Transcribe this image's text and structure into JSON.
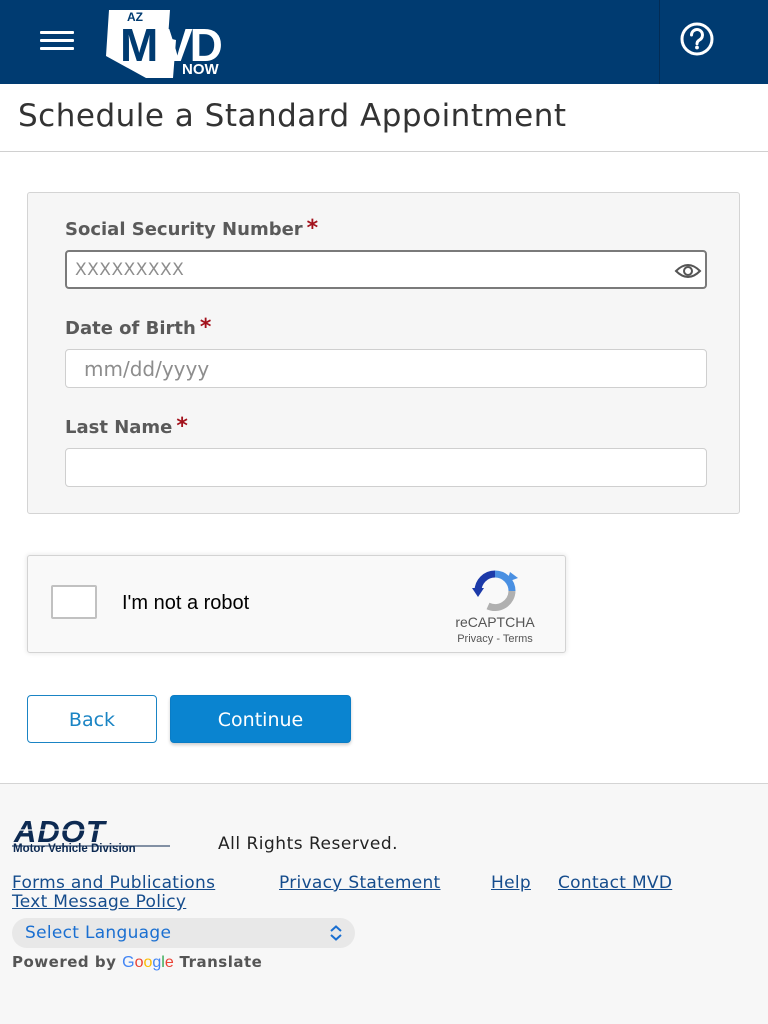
{
  "header": {
    "logo": {
      "state": "AZ",
      "brand": "MVD",
      "tagline": "NOW"
    },
    "menu_icon": "hamburger-menu-icon",
    "help_icon": "question-mark-circle-icon",
    "colors": {
      "background": "#003b71",
      "foreground": "#ffffff"
    }
  },
  "page": {
    "title": "Schedule a Standard Appointment"
  },
  "form": {
    "ssn": {
      "label": "Social Security Number",
      "required_marker": "*",
      "placeholder": "XXXXXXXXX",
      "value": "",
      "toggle_icon": "eye-icon"
    },
    "dob": {
      "label": "Date of Birth",
      "required_marker": "*",
      "placeholder": "mm/dd/yyyy",
      "value": ""
    },
    "last_name": {
      "label": "Last Name",
      "required_marker": "*",
      "placeholder": "",
      "value": ""
    },
    "required_color": "#a3121c"
  },
  "recaptcha": {
    "label": "I'm not a robot",
    "brand": "reCAPTCHA",
    "privacy": "Privacy",
    "separator": " - ",
    "terms": "Terms",
    "checked": false,
    "icon": "recaptcha-logo-icon"
  },
  "actions": {
    "back": "Back",
    "continue": "Continue",
    "primary_color": "#0a84d0"
  },
  "footer": {
    "adot_logo": {
      "brand": "ADOT",
      "subtitle": "Motor Vehicle Division"
    },
    "rights": "All Rights Reserved.",
    "links": [
      "Forms and Publications",
      "Privacy Statement",
      "Help",
      "Contact MVD",
      "Text Message Policy"
    ],
    "language": {
      "selected": "Select Language",
      "icon": "up-down-chevron-icon"
    },
    "powered": {
      "prefix": "Powered by",
      "google": "Google",
      "suffix": "Translate"
    }
  }
}
